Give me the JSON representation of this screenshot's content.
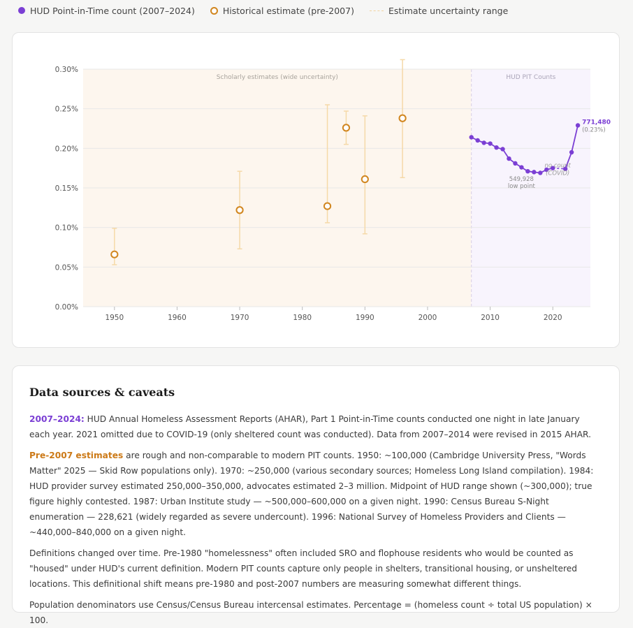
{
  "legend": {
    "hud": "HUD Point-in-Time count (2007–2024)",
    "historical": "Historical estimate (pre-2007)",
    "range": "Estimate uncertainty range"
  },
  "colors": {
    "purple": "#7b3fd4",
    "orange": "#d1861f",
    "range": "#f5d9a8",
    "region_left": "#fdf6ee",
    "region_right": "#f8f4fd"
  },
  "chart_data": {
    "type": "scatter",
    "xlim": [
      1945,
      2026
    ],
    "ylim": [
      0,
      0.3
    ],
    "x_ticks": [
      1950,
      1960,
      1970,
      1980,
      1990,
      2000,
      2010,
      2020
    ],
    "y_ticks": [
      {
        "v": 0,
        "label": "0.00%"
      },
      {
        "v": 0.05,
        "label": "0.05%"
      },
      {
        "v": 0.1,
        "label": "0.10%"
      },
      {
        "v": 0.15,
        "label": "0.15%"
      },
      {
        "v": 0.2,
        "label": "0.20%"
      },
      {
        "v": 0.25,
        "label": "0.25%"
      },
      {
        "v": 0.3,
        "label": "0.30%"
      }
    ],
    "grid": true,
    "regions": [
      {
        "label": "Scholarly estimates (wide uncertainty)",
        "from": 1945,
        "to": 2007
      },
      {
        "label": "HUD PIT Counts",
        "from": 2007,
        "to": 2026
      }
    ],
    "historical": [
      {
        "x": 1950,
        "y": 0.066,
        "lo": 0.053,
        "hi": 0.099
      },
      {
        "x": 1970,
        "y": 0.122,
        "lo": 0.073,
        "hi": 0.171
      },
      {
        "x": 1984,
        "y": 0.127,
        "lo": 0.106,
        "hi": 0.255
      },
      {
        "x": 1987,
        "y": 0.226,
        "lo": 0.205,
        "hi": 0.247
      },
      {
        "x": 1990,
        "y": 0.161,
        "lo": 0.092,
        "hi": 0.241
      },
      {
        "x": 1996,
        "y": 0.238,
        "lo": 0.163,
        "hi": 0.312
      }
    ],
    "hud": [
      {
        "x": 2007,
        "y": 0.214
      },
      {
        "x": 2008,
        "y": 0.21
      },
      {
        "x": 2009,
        "y": 0.207
      },
      {
        "x": 2010,
        "y": 0.206
      },
      {
        "x": 2011,
        "y": 0.201
      },
      {
        "x": 2012,
        "y": 0.199
      },
      {
        "x": 2013,
        "y": 0.187
      },
      {
        "x": 2014,
        "y": 0.181
      },
      {
        "x": 2015,
        "y": 0.176
      },
      {
        "x": 2016,
        "y": 0.171
      },
      {
        "x": 2017,
        "y": 0.17
      },
      {
        "x": 2018,
        "y": 0.169
      },
      {
        "x": 2019,
        "y": 0.173
      },
      {
        "x": 2020,
        "y": 0.175
      },
      {
        "x": 2022,
        "y": 0.174
      },
      {
        "x": 2023,
        "y": 0.195
      },
      {
        "x": 2024,
        "y": 0.229
      }
    ],
    "annotations": {
      "low_value": "549,928",
      "low_label": "low point",
      "gap_label": "no count",
      "gap_sub": "(COVID)",
      "end_value": "771,480",
      "end_pct": "(0.23%)"
    }
  },
  "notes": {
    "title": "Data sources & caveats",
    "p1_lead": "2007–2024:",
    "p1_text": " HUD Annual Homeless Assessment Reports (AHAR), Part 1 Point-in-Time counts conducted one night in late January each year. 2021 omitted due to COVID-19 (only sheltered count was conducted). Data from 2007–2014 were revised in 2015 AHAR.",
    "p2_lead": "Pre-2007 estimates",
    "p2_text": " are rough and non-comparable to modern PIT counts. 1950: ~100,000 (Cambridge University Press, \"Words Matter\" 2025 — Skid Row populations only). 1970: ~250,000 (various secondary sources; Homeless Long Island compilation). 1984: HUD provider survey estimated 250,000–350,000, advocates estimated 2–3 million. Midpoint of HUD range shown (~300,000); true figure highly contested. 1987: Urban Institute study — ~500,000–600,000 on a given night. 1990: Census Bureau S-Night enumeration — 228,621 (widely regarded as severe undercount). 1996: National Survey of Homeless Providers and Clients — ~440,000–840,000 on a given night.",
    "p3": "Definitions changed over time. Pre-1980 \"homelessness\" often included SRO and flophouse residents who would be counted as \"housed\" under HUD's current definition. Modern PIT counts capture only people in shelters, transitional housing, or unsheltered locations. This definitional shift means pre-1980 and post-2007 numbers are measuring somewhat different things.",
    "p4": "Population denominators use Census/Census Bureau intercensal estimates. Percentage = (homeless count ÷ total US population) × 100."
  }
}
